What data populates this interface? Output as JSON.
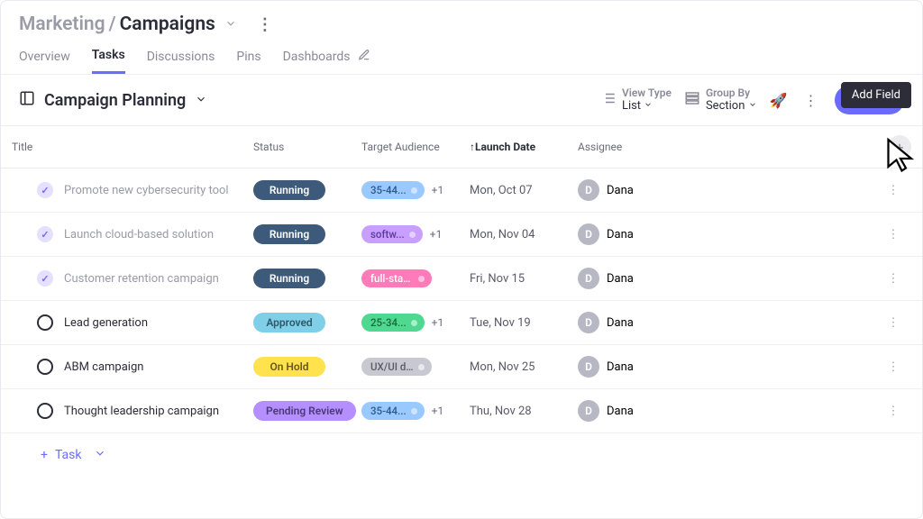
{
  "breadcrumb": {
    "parent": "Marketing",
    "current": "Campaigns"
  },
  "tabs": [
    "Overview",
    "Tasks",
    "Discussions",
    "Pins",
    "Dashboards"
  ],
  "active_tab": "Tasks",
  "section": {
    "title": "Campaign Planning"
  },
  "toolbar": {
    "viewtype_label": "View Type",
    "viewtype_value": "List",
    "groupby_label": "Group By",
    "groupby_value": "Section",
    "task_button": "Task",
    "tooltip": "Add Field"
  },
  "columns": [
    "Title",
    "Status",
    "Target Audience",
    "Launch Date",
    "Assignee"
  ],
  "sort_column": "Launch Date",
  "rows": [
    {
      "done": true,
      "title": "Promote new cybersecurity tool",
      "status": "Running",
      "tag": "35-44...",
      "tag_color": "blue",
      "extra": "+1",
      "date": "Mon, Oct 07",
      "assignee": "Dana",
      "initial": "D"
    },
    {
      "done": true,
      "title": "Launch cloud-based solution",
      "status": "Running",
      "tag": "softw...",
      "tag_color": "purple",
      "extra": "+1",
      "date": "Mon, Nov 04",
      "assignee": "Dana",
      "initial": "D"
    },
    {
      "done": true,
      "title": "Customer retention campaign",
      "status": "Running",
      "tag": "full-stack dev...",
      "tag_color": "pink",
      "extra": "",
      "date": "Fri, Nov 15",
      "assignee": "Dana",
      "initial": "D"
    },
    {
      "done": false,
      "title": "Lead generation",
      "status": "Approved",
      "tag": "25-34...",
      "tag_color": "green",
      "extra": "+1",
      "date": "Tue, Nov 19",
      "assignee": "Dana",
      "initial": "D"
    },
    {
      "done": false,
      "title": "ABM campaign",
      "status": "On Hold",
      "tag": "UX/UI design...",
      "tag_color": "gray",
      "extra": "",
      "date": "Mon, Nov 25",
      "assignee": "Dana",
      "initial": "D"
    },
    {
      "done": false,
      "title": "Thought leadership campaign",
      "status": "Pending Review",
      "tag": "35-44...",
      "tag_color": "blue",
      "extra": "+1",
      "date": "Thu, Nov 28",
      "assignee": "Dana",
      "initial": "D"
    }
  ],
  "add_task_label": "Task"
}
